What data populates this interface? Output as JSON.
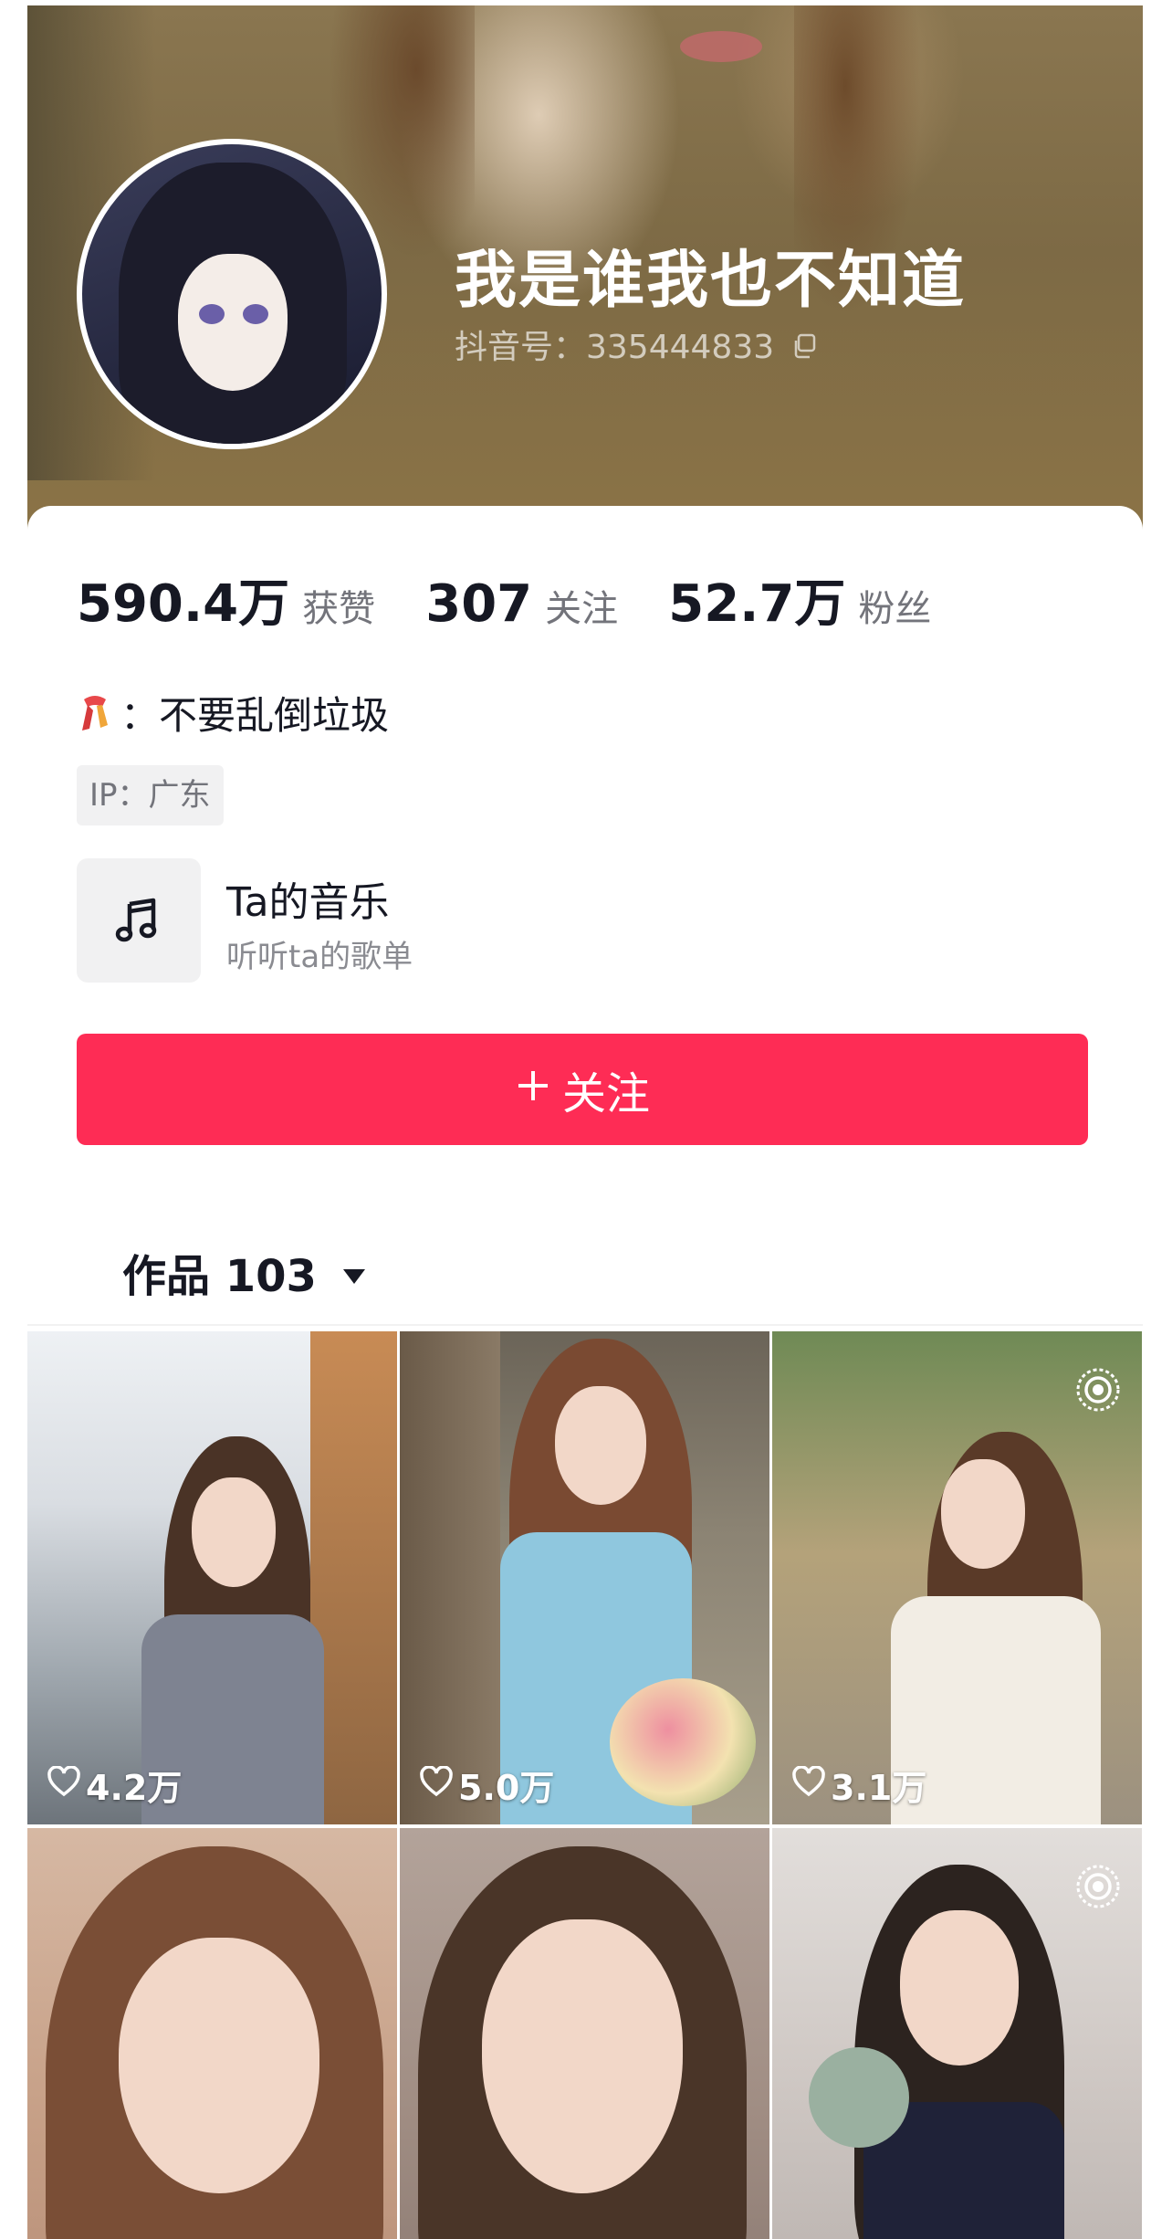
{
  "profile": {
    "username": "我是谁我也不知道",
    "douyin_id": "抖音号：335444833"
  },
  "stats": [
    {
      "value": "590.4万",
      "label": "获赞"
    },
    {
      "value": "307",
      "label": "关注"
    },
    {
      "value": "52.7万",
      "label": "粉丝"
    }
  ],
  "bio": {
    "text": "：不要乱倒垃圾",
    "icon": "scarf-icon"
  },
  "ip_location": "IP：广东",
  "music": {
    "title": "Ta的音乐",
    "subtitle": "听听ta的歌单",
    "icon": "music-note-icon"
  },
  "follow_button": {
    "label": "关注",
    "icon": "plus-icon",
    "color": "#fe2c55"
  },
  "works_tab": {
    "label": "作品 103"
  },
  "videos": [
    {
      "likes": "4.2万",
      "live": false
    },
    {
      "likes": "5.0万",
      "live": false
    },
    {
      "likes": "3.1万",
      "live": true
    },
    {
      "likes": "",
      "live": false
    },
    {
      "likes": "",
      "live": false
    },
    {
      "likes": "",
      "live": true
    }
  ],
  "colors": {
    "accent": "#fe2c55",
    "banner": "#7d6a45",
    "secondary_text": "#73747b"
  }
}
